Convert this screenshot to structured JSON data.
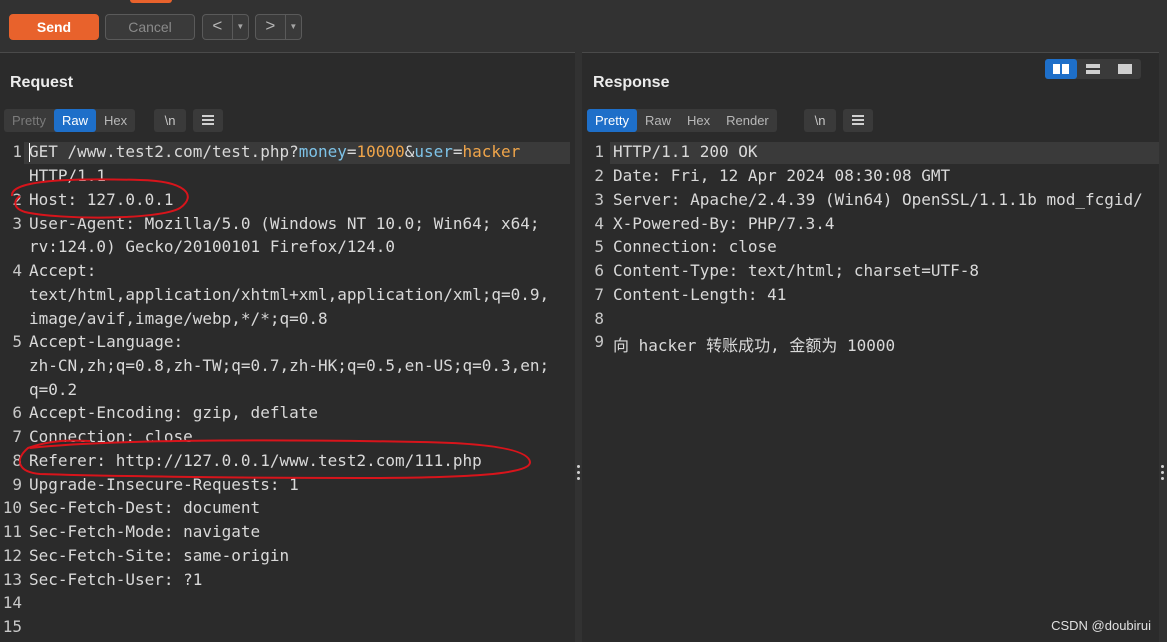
{
  "toolbar": {
    "send_label": "Send",
    "cancel_label": "Cancel",
    "back_label": "<",
    "forward_label": ">",
    "dropdown_glyph": "▼"
  },
  "request": {
    "title": "Request",
    "view_tabs": [
      "Pretty",
      "Raw",
      "Hex"
    ],
    "active_tab": "Raw",
    "newline_toggle": "\\n",
    "menu_icon": "hamburger-icon",
    "line_numbers": [
      "1",
      "2",
      "3",
      "4",
      "5",
      "6",
      "7",
      "8",
      "9",
      "10",
      "11",
      "12",
      "13",
      "14",
      "15"
    ],
    "lines": {
      "l1_method": "GET /www.test2.com/test.php?",
      "l1_k1": "money",
      "l1_eq1": "=",
      "l1_v1": "10000",
      "l1_amp": "&",
      "l1_k2": "user",
      "l1_eq2": "=",
      "l1_v2": "hacker",
      "l1_cont": "HTTP/1.1",
      "l2": "Host: 127.0.0.1",
      "l3": "User-Agent: Mozilla/5.0 (Windows NT 10.0; Win64; x64;",
      "l3_cont": "rv:124.0) Gecko/20100101 Firefox/124.0",
      "l4": "Accept:",
      "l4_cont1": "text/html,application/xhtml+xml,application/xml;q=0.9,",
      "l4_cont2": "image/avif,image/webp,*/*;q=0.8",
      "l5": "Accept-Language:",
      "l5_cont1": "zh-CN,zh;q=0.8,zh-TW;q=0.7,zh-HK;q=0.5,en-US;q=0.3,en;",
      "l5_cont2": "q=0.2",
      "l6": "Accept-Encoding: gzip, deflate",
      "l7": "Connection: close",
      "l8": "Referer: http://127.0.0.1/www.test2.com/111.php",
      "l9": "Upgrade-Insecure-Requests: 1",
      "l10": "Sec-Fetch-Dest: document",
      "l11": "Sec-Fetch-Mode: navigate",
      "l12": "Sec-Fetch-Site: same-origin",
      "l13": "Sec-Fetch-User: ?1"
    }
  },
  "response": {
    "title": "Response",
    "view_tabs": [
      "Pretty",
      "Raw",
      "Hex",
      "Render"
    ],
    "active_tab": "Pretty",
    "newline_toggle": "\\n",
    "menu_icon": "hamburger-icon",
    "line_numbers": [
      "1",
      "2",
      "3",
      "4",
      "5",
      "6",
      "7",
      "8",
      "9"
    ],
    "lines": {
      "l1": "HTTP/1.1 200 OK",
      "l2": "Date: Fri, 12 Apr 2024 08:30:08 GMT",
      "l3": "Server: Apache/2.4.39 (Win64) OpenSSL/1.1.1b mod_fcgid/",
      "l4": "X-Powered-By: PHP/7.3.4",
      "l5": "Connection: close",
      "l6": "Content-Type: text/html; charset=UTF-8",
      "l7": "Content-Length: 41",
      "l8": "",
      "l9": "向 hacker 转账成功, 金额为 10000"
    }
  },
  "layout_icons": [
    "split-columns-icon",
    "split-rows-icon",
    "single-pane-icon"
  ],
  "annotations": {
    "color": "#d8141b",
    "shape": "hand-drawn ellipse"
  },
  "watermark": "CSDN @doubirui",
  "colors": {
    "accent": "#e8622c",
    "active_tab": "#1e6fc9",
    "param_key": "#7ec3e8",
    "param_value": "#f0a54a"
  }
}
